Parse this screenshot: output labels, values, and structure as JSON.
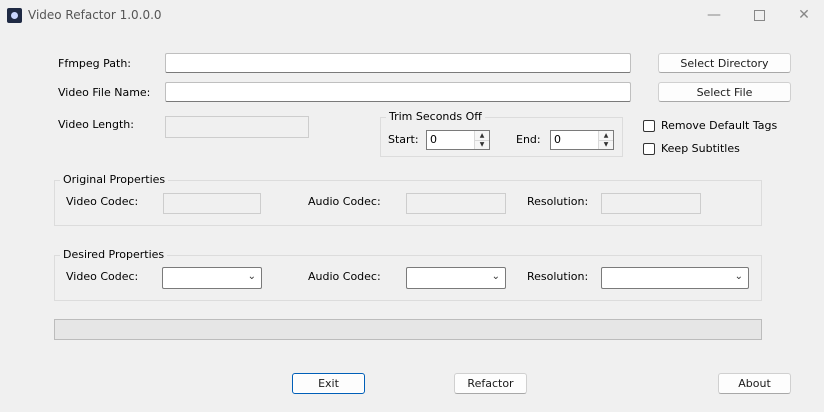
{
  "window": {
    "title": "Video Refactor 1.0.0.0",
    "minimize_icon": "minimize-icon",
    "maximize_icon": "maximize-icon",
    "close_icon": "close-icon"
  },
  "paths": {
    "ffmpeg_label": "Ffmpeg Path:",
    "ffmpeg_value": "",
    "video_file_label": "Video File Name:",
    "video_file_value": "",
    "video_length_label": "Video Length:",
    "video_length_value": "",
    "select_directory_label": "Select Directory",
    "select_file_label": "Select File"
  },
  "trim": {
    "title": "Trim Seconds Off",
    "start_label": "Start:",
    "start_value": "0",
    "end_label": "End:",
    "end_value": "0"
  },
  "options": {
    "remove_default_tags_label": "Remove Default Tags",
    "remove_default_tags_checked": false,
    "keep_subtitles_label": "Keep Subtitles",
    "keep_subtitles_checked": false
  },
  "original": {
    "title": "Original Properties",
    "video_codec_label": "Video Codec:",
    "video_codec_value": "",
    "audio_codec_label": "Audio Codec:",
    "audio_codec_value": "",
    "resolution_label": "Resolution:",
    "resolution_value": ""
  },
  "desired": {
    "title": "Desired Properties",
    "video_codec_label": "Video Codec:",
    "video_codec_value": "",
    "audio_codec_label": "Audio Codec:",
    "audio_codec_value": "",
    "resolution_label": "Resolution:",
    "resolution_value": ""
  },
  "progress": {
    "value_percent": 0
  },
  "footer": {
    "exit_label": "Exit",
    "refactor_label": "Refactor",
    "about_label": "About"
  }
}
